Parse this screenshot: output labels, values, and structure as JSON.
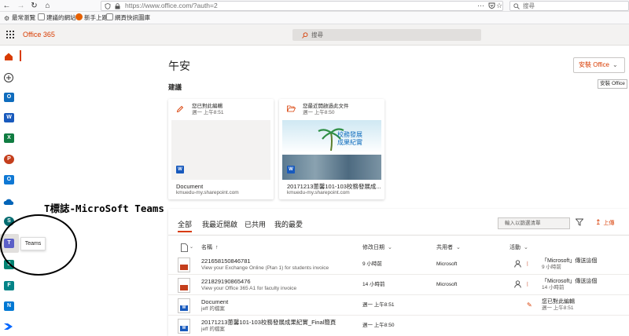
{
  "browser": {
    "url": "https://www.office.com/?auth=2",
    "search_placeholder": "搜尋"
  },
  "bookmarks": [
    "最常瀏覽",
    "建議的網站",
    "新手上路",
    "網頁快訊圖庫"
  ],
  "header": {
    "brand": "Office 365",
    "search_placeholder": "搜尋"
  },
  "rail": {
    "teams_tooltip": "Teams"
  },
  "main": {
    "greeting": "午安",
    "install_button": "安裝 Office",
    "install_tooltip": "安裝 Office",
    "recommended_title": "建議",
    "cards": [
      {
        "activity": "您已對此編輯",
        "time": "週一 上午8:51",
        "name": "Document",
        "site": "kmuedu-my.sharepoint.com"
      },
      {
        "activity": "您最近開啟過此文件",
        "time": "週一 上午8:50",
        "name": "20171213蔥馨101-103校務發展成...",
        "site": "kmuedu-my.sharepoint.com",
        "thumb_lines": [
          "校務發展",
          "成果紀實"
        ]
      }
    ]
  },
  "annotation": "T標誌-MicroSoft Teams",
  "files": {
    "tabs": [
      "全部",
      "我最近開啟",
      "已共用",
      "我的最愛"
    ],
    "filter_placeholder": "輸入以篩選清單",
    "upload_label": "上傳",
    "columns": {
      "name": "名稱",
      "modified": "修改日期",
      "shared_by": "共用者",
      "activity": "活動"
    },
    "rows": [
      {
        "name": "221658150846781",
        "sub": "View your Exchange Online (Plan 1) for students invoice",
        "modified": "9 小時前",
        "shared_by": "Microsoft",
        "act1": "「Microsoft」傳送這個",
        "act2": "9 小時前"
      },
      {
        "name": "221829190865476",
        "sub": "View your Office 365 A1 for faculty invoice",
        "modified": "14 小時前",
        "shared_by": "Microsoft",
        "act1": "「Microsoft」傳送這個",
        "act2": "14 小時前"
      },
      {
        "name": "Document",
        "sub": "jeff 的檔案",
        "modified": "週一 上午8:51",
        "shared_by": "",
        "act1": "您已對此編輯",
        "act2": "週一 上午8:51"
      },
      {
        "name": "20171213蔥馨101-103校務發展成果紀實_Final簡頁",
        "sub": "jeff 的檔案",
        "modified": "週一 上午8:50",
        "shared_by": "",
        "act1": "",
        "act2": ""
      }
    ]
  },
  "colors": {
    "accent": "#d83b01",
    "word": "#185abd",
    "excel": "#107c41",
    "powerpoint": "#c43e1c",
    "teams": "#5b5fc7",
    "outlook": "#0f6cbd"
  }
}
